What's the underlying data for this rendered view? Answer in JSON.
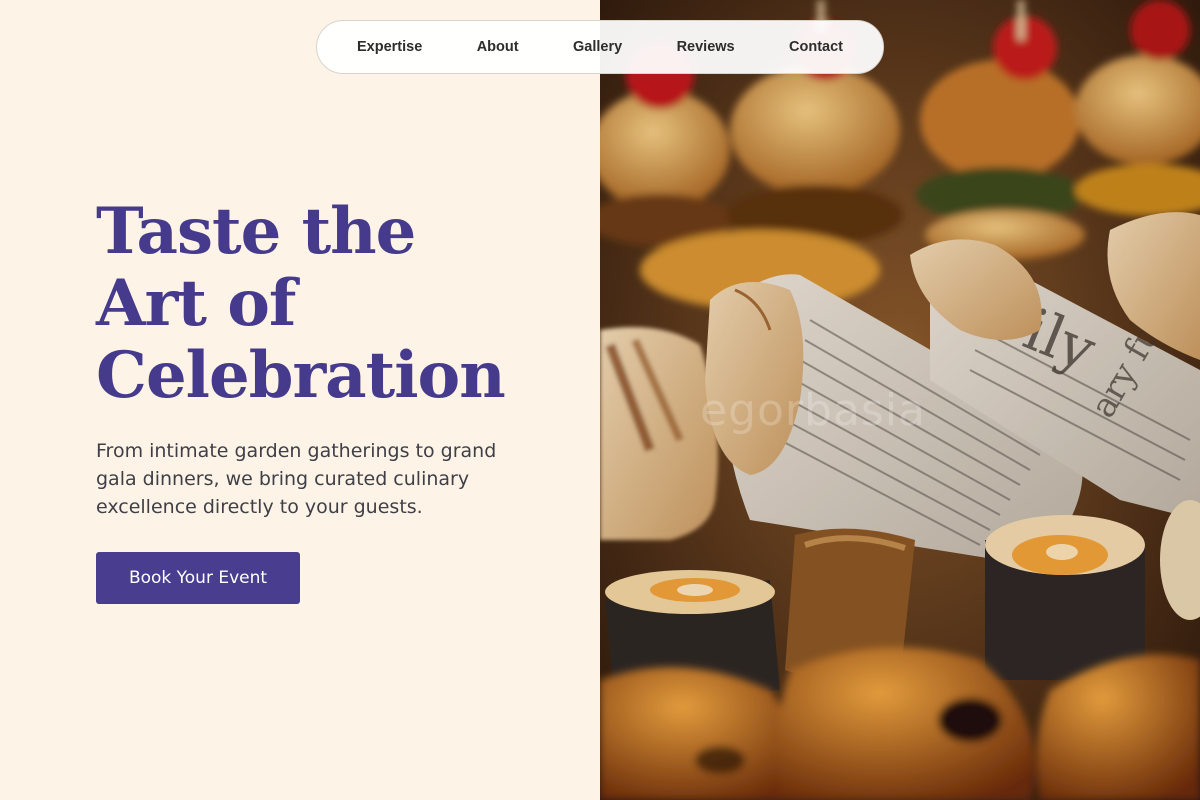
{
  "nav": {
    "items": [
      "Expertise",
      "About",
      "Gallery",
      "Reviews",
      "Contact"
    ]
  },
  "hero": {
    "title_lines": [
      "Taste the",
      "Art of",
      "Celebration"
    ],
    "subtitle": "From intimate garden gatherings to grand gala dinners, we bring curated culinary excellence directly to your guests.",
    "cta_label": "Book Your Event"
  },
  "image": {
    "alt": "Catering platter with sliders, wraps in newspaper, and rolls",
    "watermark": "egorbasia"
  },
  "colors": {
    "background": "#fdf4e7",
    "accent": "#483d8e",
    "title": "#453a8c",
    "body_text": "#3f3f48"
  }
}
